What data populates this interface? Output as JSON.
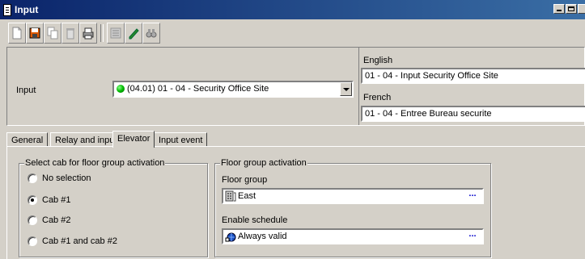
{
  "window": {
    "title": "Input"
  },
  "toolbar": {
    "icons": [
      "new-document-icon",
      "save-icon",
      "copy-icon",
      "delete-icon",
      "print-icon",
      "list-icon",
      "edit-pencil-icon",
      "find-binoculars-icon"
    ]
  },
  "input": {
    "label": "Input",
    "selected": "(04.01) 01 - 04 - Security Office Site",
    "status_color": "#00b000"
  },
  "names": {
    "english_label": "English",
    "english_value": "01 - 04 - Input Security Office Site",
    "french_label": "French",
    "french_value": "01 - 04 - Entree Bureau securite"
  },
  "tabs": [
    {
      "label": "General"
    },
    {
      "label": "Relay and input"
    },
    {
      "label": "Elevator",
      "active": true
    },
    {
      "label": "Input event"
    }
  ],
  "cab_group": {
    "title": "Select cab for floor group activation",
    "options": [
      {
        "label": "No selection",
        "checked": false
      },
      {
        "label": "Cab #1",
        "checked": true
      },
      {
        "label": "Cab #2",
        "checked": false
      },
      {
        "label": "Cab #1 and cab #2",
        "checked": false
      }
    ]
  },
  "floor_group": {
    "title": "Floor group activation",
    "floor_label": "Floor group",
    "floor_value": "East",
    "schedule_label": "Enable schedule",
    "schedule_value": "Always valid",
    "browse_label": "..."
  }
}
